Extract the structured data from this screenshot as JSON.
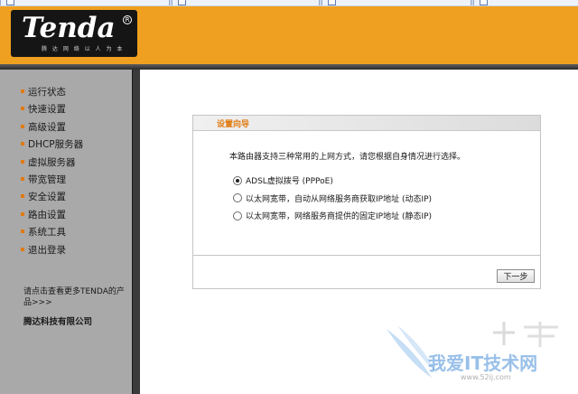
{
  "brand": {
    "logo_text": "Tenda",
    "registered_mark": "R",
    "slogan": "腾 达 网 络 以 人 为 本"
  },
  "sidebar": {
    "items": [
      {
        "label": "运行状态"
      },
      {
        "label": "快速设置"
      },
      {
        "label": "高级设置"
      },
      {
        "label": "DHCP服务器"
      },
      {
        "label": "虚拟服务器"
      },
      {
        "label": "带宽管理"
      },
      {
        "label": "安全设置"
      },
      {
        "label": "路由设置"
      },
      {
        "label": "系统工具"
      },
      {
        "label": "退出登录"
      }
    ],
    "promo_text": "请点击查看更多TENDA的产品>>>",
    "company": "腾达科技有限公司"
  },
  "wizard": {
    "title": "设置向导",
    "description": "本路由器支持三种常用的上网方式，请您根据自身情况进行选择。",
    "options": [
      {
        "label": "ADSL虚拟拨号 (PPPoE)",
        "selected": true
      },
      {
        "label": "以太网宽带，自动从网络服务商获取IP地址 (动态IP)",
        "selected": false
      },
      {
        "label": "以太网宽带，网络服务商提供的固定IP地址 (静态IP)",
        "selected": false
      }
    ],
    "next_label": "下一步"
  },
  "watermark": {
    "text": "我爱IT技术网",
    "url": "www.52ij.com"
  },
  "colors": {
    "header": "#f0a020",
    "sidebar": "#a9a9a9",
    "accent": "#e07a10"
  }
}
